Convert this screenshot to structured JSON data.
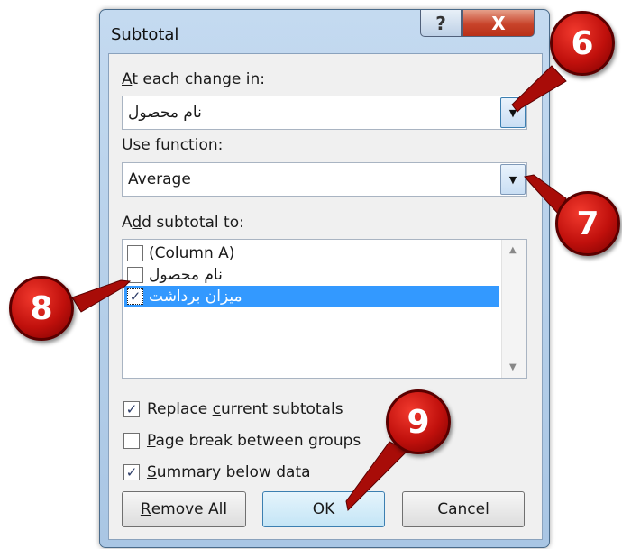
{
  "dialog": {
    "title": "Subtotal",
    "help_glyph": "?",
    "close_glyph": "X"
  },
  "at_each_change": {
    "label_prefix": "A",
    "label_rest": "t each change in:",
    "value": "نام محصول"
  },
  "use_function": {
    "label_prefix": "U",
    "label_rest": "se function:",
    "value": "Average"
  },
  "add_subtotal": {
    "label_prefix": "A",
    "label_u": "d",
    "label_rest": "d subtotal to:",
    "items": [
      {
        "label": "(Column A)",
        "checked": false,
        "selected": false
      },
      {
        "label": "نام محصول",
        "checked": false,
        "selected": false
      },
      {
        "label": "میزان برداشت",
        "checked": true,
        "selected": true
      }
    ]
  },
  "options": {
    "replace": {
      "pre": "Replace ",
      "u": "c",
      "post": "urrent subtotals",
      "checked": true
    },
    "page_break": {
      "pre": "",
      "u": "P",
      "post": "age break between groups",
      "checked": false
    },
    "summary": {
      "pre": "",
      "u": "S",
      "post": "ummary below data",
      "checked": true
    }
  },
  "buttons": {
    "remove_all_u": "R",
    "remove_all_rest": "emove All",
    "ok": "OK",
    "cancel": "Cancel"
  },
  "callouts": [
    "6",
    "7",
    "8",
    "9"
  ],
  "colors": {
    "callout_red": "#c0100c",
    "selection_blue": "#3399ff",
    "close_red": "#c8432a"
  }
}
